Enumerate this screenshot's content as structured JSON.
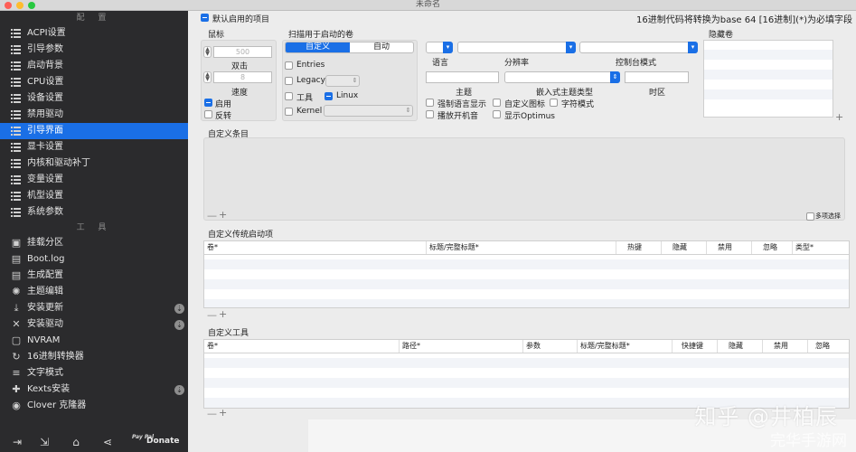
{
  "window": {
    "title": "未命名"
  },
  "sidebar": {
    "section_config": "配 置",
    "config_items": [
      {
        "label": "ACPI设置"
      },
      {
        "label": "引导参数"
      },
      {
        "label": "启动背景"
      },
      {
        "label": "CPU设置"
      },
      {
        "label": "设备设置"
      },
      {
        "label": "禁用驱动"
      },
      {
        "label": "引导界面",
        "selected": true
      },
      {
        "label": "显卡设置"
      },
      {
        "label": "内核和驱动补丁"
      },
      {
        "label": "变量设置"
      },
      {
        "label": "机型设置"
      },
      {
        "label": "系统参数"
      }
    ],
    "section_tools": "工 具",
    "tool_items": [
      {
        "label": "挂载分区",
        "icon": "disk-icon"
      },
      {
        "label": "Boot.log",
        "icon": "document-icon"
      },
      {
        "label": "生成配置",
        "icon": "document-icon"
      },
      {
        "label": "主题编辑",
        "icon": "palette-icon"
      },
      {
        "label": "安装更新",
        "icon": "download-icon",
        "badge": "⇣"
      },
      {
        "label": "安装驱动",
        "icon": "tools-icon",
        "badge": "⇣"
      },
      {
        "label": "NVRAM",
        "icon": "chip-icon"
      },
      {
        "label": "16进制转换器",
        "icon": "refresh-icon"
      },
      {
        "label": "文字模式",
        "icon": "text-icon"
      },
      {
        "label": "Kexts安装",
        "icon": "puzzle-icon",
        "badge": "⇣"
      },
      {
        "label": "Clover 克隆器",
        "icon": "clone-icon"
      }
    ],
    "bottom": {
      "paypal": "Pay Pal",
      "donate": "Donate"
    }
  },
  "main": {
    "default_boot": {
      "label": "默认启用的项目",
      "checked": true
    },
    "hint": "16进制代码将转换为base 64 [16进制](*)为必填字段",
    "mouse": {
      "title": "鼠标",
      "speed_placeholder": "500",
      "double_click_label": "双击",
      "speed_value": "8",
      "speed_label": "速度",
      "enabled_label": "启用",
      "reverse_label": "反转"
    },
    "scan": {
      "title": "扫描用于启动的卷",
      "seg_custom": "自定义",
      "seg_auto": "自动",
      "entries": "Entries",
      "legacy": "Legacy",
      "tools": "工具",
      "linux": "Linux",
      "kernel": "Kernel"
    },
    "lang_label": "语言",
    "resolution_label": "分辨率",
    "console_label": "控制台模式",
    "theme_label": "主题",
    "embedded_theme_label": "嵌入式主题类型",
    "timezone_label": "时区",
    "options": {
      "force_lang": "强制语言显示",
      "custom_icons": "自定义图标",
      "char_mode": "字符模式",
      "play_sound": "播放开机音",
      "show_optimus": "显示Optimus"
    },
    "hidden_volumes": {
      "title": "隐藏卷"
    },
    "custom_entries": {
      "title": "自定义条目",
      "multi_select": "多项选择"
    },
    "custom_legacy": {
      "title": "自定义传统启动项",
      "columns": [
        "卷*",
        "标题/完整标题*",
        "热键",
        "隐藏",
        "禁用",
        "忽略",
        "类型*"
      ]
    },
    "custom_tools": {
      "title": "自定义工具",
      "columns": [
        "卷*",
        "路径*",
        "参数",
        "标题/完整标题*",
        "快捷键",
        "隐藏",
        "禁用",
        "忽略"
      ]
    },
    "controls": {
      "minus": "—",
      "plus": "+"
    },
    "watermark": "知乎 @井柏辰",
    "watermark_sub": "完华手游网"
  }
}
